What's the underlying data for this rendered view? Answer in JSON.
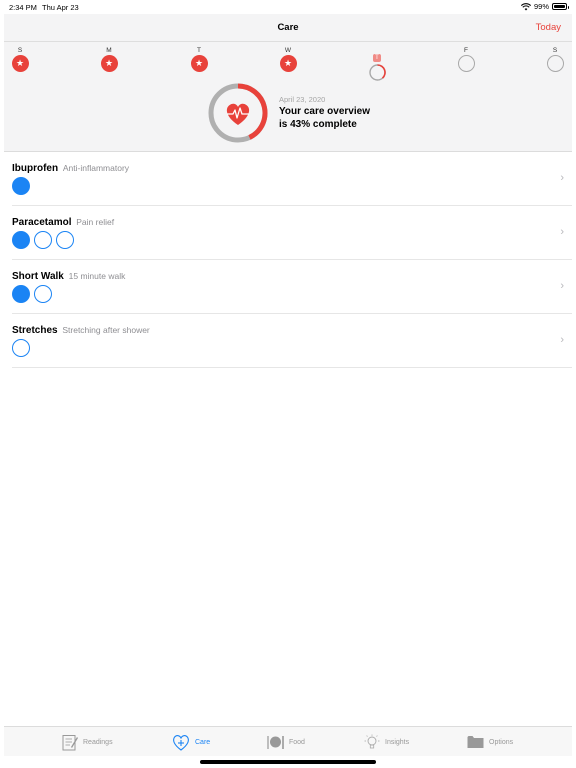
{
  "status": {
    "time": "2:34 PM",
    "date": "Thu Apr 23",
    "battery": "99%"
  },
  "nav": {
    "title": "Care",
    "today": "Today"
  },
  "week": [
    {
      "label": "S",
      "state": "done"
    },
    {
      "label": "M",
      "state": "done"
    },
    {
      "label": "T",
      "state": "done"
    },
    {
      "label": "W",
      "state": "done"
    },
    {
      "label": "T",
      "state": "partial",
      "is_today": true
    },
    {
      "label": "F",
      "state": "empty"
    },
    {
      "label": "S",
      "state": "empty"
    }
  ],
  "overview": {
    "date": "April 23, 2020",
    "line1": "Your care overview",
    "line2": "is 43% complete",
    "progress": 0.43
  },
  "tasks": [
    {
      "title": "Ibuprofen",
      "subtitle": "Anti-inflammatory",
      "doses": [
        true
      ]
    },
    {
      "title": "Paracetamol",
      "subtitle": "Pain relief",
      "doses": [
        true,
        false,
        false
      ]
    },
    {
      "title": "Short Walk",
      "subtitle": "15 minute walk",
      "doses": [
        true,
        false
      ]
    },
    {
      "title": "Stretches",
      "subtitle": "Stretching after shower",
      "doses": [
        false
      ]
    }
  ],
  "tabs": [
    {
      "label": "Readings",
      "icon": "notepad-icon",
      "active": false
    },
    {
      "label": "Care",
      "icon": "heart-plus-icon",
      "active": true
    },
    {
      "label": "Food",
      "icon": "fork-knife-icon",
      "active": false
    },
    {
      "label": "Insights",
      "icon": "lightbulb-icon",
      "active": false
    },
    {
      "label": "Options",
      "icon": "folder-icon",
      "active": false
    }
  ],
  "colors": {
    "accent_red": "#e8423b",
    "accent_blue": "#1b84f4",
    "ring_gray": "#b0b0b0"
  }
}
